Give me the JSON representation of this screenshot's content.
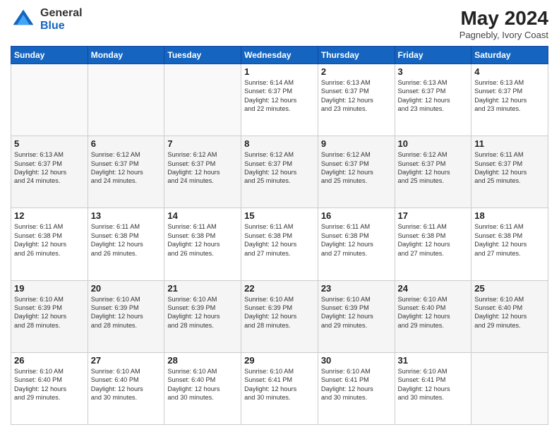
{
  "header": {
    "logo": {
      "general": "General",
      "blue": "Blue"
    },
    "title": "May 2024",
    "location": "Pagnebly, Ivory Coast"
  },
  "weekdays": [
    "Sunday",
    "Monday",
    "Tuesday",
    "Wednesday",
    "Thursday",
    "Friday",
    "Saturday"
  ],
  "weeks": [
    [
      {
        "day": "",
        "info": ""
      },
      {
        "day": "",
        "info": ""
      },
      {
        "day": "",
        "info": ""
      },
      {
        "day": "1",
        "info": "Sunrise: 6:14 AM\nSunset: 6:37 PM\nDaylight: 12 hours\nand 22 minutes."
      },
      {
        "day": "2",
        "info": "Sunrise: 6:13 AM\nSunset: 6:37 PM\nDaylight: 12 hours\nand 23 minutes."
      },
      {
        "day": "3",
        "info": "Sunrise: 6:13 AM\nSunset: 6:37 PM\nDaylight: 12 hours\nand 23 minutes."
      },
      {
        "day": "4",
        "info": "Sunrise: 6:13 AM\nSunset: 6:37 PM\nDaylight: 12 hours\nand 23 minutes."
      }
    ],
    [
      {
        "day": "5",
        "info": "Sunrise: 6:13 AM\nSunset: 6:37 PM\nDaylight: 12 hours\nand 24 minutes."
      },
      {
        "day": "6",
        "info": "Sunrise: 6:12 AM\nSunset: 6:37 PM\nDaylight: 12 hours\nand 24 minutes."
      },
      {
        "day": "7",
        "info": "Sunrise: 6:12 AM\nSunset: 6:37 PM\nDaylight: 12 hours\nand 24 minutes."
      },
      {
        "day": "8",
        "info": "Sunrise: 6:12 AM\nSunset: 6:37 PM\nDaylight: 12 hours\nand 25 minutes."
      },
      {
        "day": "9",
        "info": "Sunrise: 6:12 AM\nSunset: 6:37 PM\nDaylight: 12 hours\nand 25 minutes."
      },
      {
        "day": "10",
        "info": "Sunrise: 6:12 AM\nSunset: 6:37 PM\nDaylight: 12 hours\nand 25 minutes."
      },
      {
        "day": "11",
        "info": "Sunrise: 6:11 AM\nSunset: 6:37 PM\nDaylight: 12 hours\nand 25 minutes."
      }
    ],
    [
      {
        "day": "12",
        "info": "Sunrise: 6:11 AM\nSunset: 6:38 PM\nDaylight: 12 hours\nand 26 minutes."
      },
      {
        "day": "13",
        "info": "Sunrise: 6:11 AM\nSunset: 6:38 PM\nDaylight: 12 hours\nand 26 minutes."
      },
      {
        "day": "14",
        "info": "Sunrise: 6:11 AM\nSunset: 6:38 PM\nDaylight: 12 hours\nand 26 minutes."
      },
      {
        "day": "15",
        "info": "Sunrise: 6:11 AM\nSunset: 6:38 PM\nDaylight: 12 hours\nand 27 minutes."
      },
      {
        "day": "16",
        "info": "Sunrise: 6:11 AM\nSunset: 6:38 PM\nDaylight: 12 hours\nand 27 minutes."
      },
      {
        "day": "17",
        "info": "Sunrise: 6:11 AM\nSunset: 6:38 PM\nDaylight: 12 hours\nand 27 minutes."
      },
      {
        "day": "18",
        "info": "Sunrise: 6:11 AM\nSunset: 6:38 PM\nDaylight: 12 hours\nand 27 minutes."
      }
    ],
    [
      {
        "day": "19",
        "info": "Sunrise: 6:10 AM\nSunset: 6:39 PM\nDaylight: 12 hours\nand 28 minutes."
      },
      {
        "day": "20",
        "info": "Sunrise: 6:10 AM\nSunset: 6:39 PM\nDaylight: 12 hours\nand 28 minutes."
      },
      {
        "day": "21",
        "info": "Sunrise: 6:10 AM\nSunset: 6:39 PM\nDaylight: 12 hours\nand 28 minutes."
      },
      {
        "day": "22",
        "info": "Sunrise: 6:10 AM\nSunset: 6:39 PM\nDaylight: 12 hours\nand 28 minutes."
      },
      {
        "day": "23",
        "info": "Sunrise: 6:10 AM\nSunset: 6:39 PM\nDaylight: 12 hours\nand 29 minutes."
      },
      {
        "day": "24",
        "info": "Sunrise: 6:10 AM\nSunset: 6:40 PM\nDaylight: 12 hours\nand 29 minutes."
      },
      {
        "day": "25",
        "info": "Sunrise: 6:10 AM\nSunset: 6:40 PM\nDaylight: 12 hours\nand 29 minutes."
      }
    ],
    [
      {
        "day": "26",
        "info": "Sunrise: 6:10 AM\nSunset: 6:40 PM\nDaylight: 12 hours\nand 29 minutes."
      },
      {
        "day": "27",
        "info": "Sunrise: 6:10 AM\nSunset: 6:40 PM\nDaylight: 12 hours\nand 30 minutes."
      },
      {
        "day": "28",
        "info": "Sunrise: 6:10 AM\nSunset: 6:40 PM\nDaylight: 12 hours\nand 30 minutes."
      },
      {
        "day": "29",
        "info": "Sunrise: 6:10 AM\nSunset: 6:41 PM\nDaylight: 12 hours\nand 30 minutes."
      },
      {
        "day": "30",
        "info": "Sunrise: 6:10 AM\nSunset: 6:41 PM\nDaylight: 12 hours\nand 30 minutes."
      },
      {
        "day": "31",
        "info": "Sunrise: 6:10 AM\nSunset: 6:41 PM\nDaylight: 12 hours\nand 30 minutes."
      },
      {
        "day": "",
        "info": ""
      }
    ]
  ]
}
